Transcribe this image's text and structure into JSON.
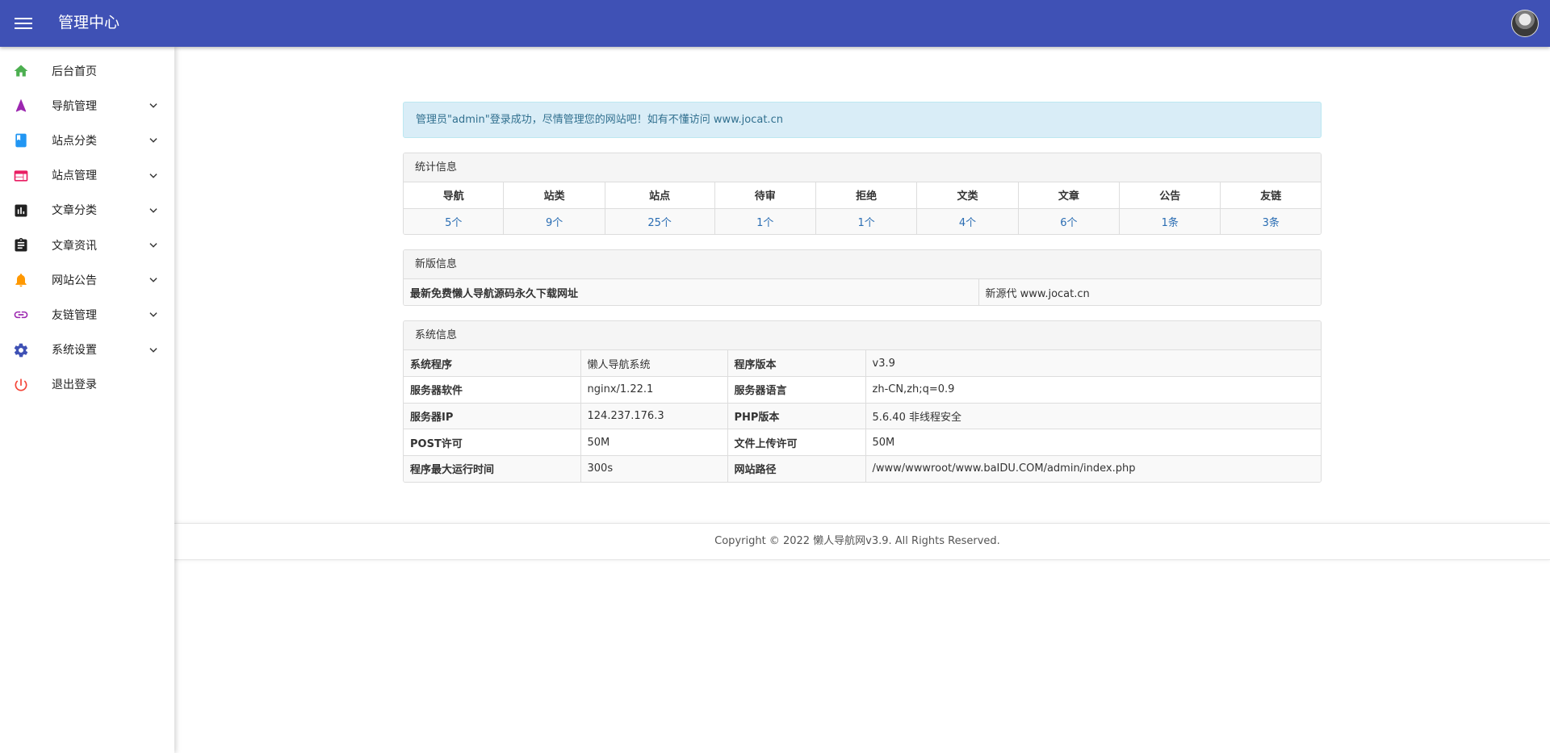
{
  "header": {
    "title": "管理中心"
  },
  "sidebar": {
    "items": [
      {
        "label": "后台首页",
        "icon": "home-icon",
        "color": "#4caf50",
        "expandable": false
      },
      {
        "label": "导航管理",
        "icon": "navigation-icon",
        "color": "#9c27b0",
        "expandable": true
      },
      {
        "label": "站点分类",
        "icon": "book-icon",
        "color": "#2196f3",
        "expandable": true
      },
      {
        "label": "站点管理",
        "icon": "web-icon",
        "color": "#e91e63",
        "expandable": true
      },
      {
        "label": "文章分类",
        "icon": "chart-icon",
        "color": "#212121",
        "expandable": true
      },
      {
        "label": "文章资讯",
        "icon": "clipboard-icon",
        "color": "#212121",
        "expandable": true
      },
      {
        "label": "网站公告",
        "icon": "bell-icon",
        "color": "#ff9800",
        "expandable": true
      },
      {
        "label": "友链管理",
        "icon": "link-icon",
        "color": "#9c27b0",
        "expandable": true
      },
      {
        "label": "系统设置",
        "icon": "gear-icon",
        "color": "#3f51b5",
        "expandable": true
      },
      {
        "label": "退出登录",
        "icon": "power-icon",
        "color": "#f44336",
        "expandable": false
      }
    ]
  },
  "alert": {
    "text": "管理员\"admin\"登录成功，尽情管理您的网站吧！如有不懂访问 www.jocat.cn"
  },
  "stats": {
    "title": "统计信息",
    "headers": [
      "导航",
      "站类",
      "站点",
      "待审",
      "拒绝",
      "文类",
      "文章",
      "公告",
      "友链"
    ],
    "values": [
      "5个",
      "9个",
      "25个",
      "1个",
      "1个",
      "4个",
      "6个",
      "1条",
      "3条"
    ]
  },
  "version": {
    "title": "新版信息",
    "label": "最新免费懒人导航源码永久下载网址",
    "value": "新源代 www.jocat.cn"
  },
  "system": {
    "title": "系统信息",
    "rows": [
      {
        "k1": "系统程序",
        "v1": "懒人导航系统",
        "k2": "程序版本",
        "v2": "v3.9"
      },
      {
        "k1": "服务器软件",
        "v1": "nginx/1.22.1",
        "k2": "服务器语言",
        "v2": "zh-CN,zh;q=0.9"
      },
      {
        "k1": "服务器IP",
        "v1": "124.237.176.3",
        "k2": "PHP版本",
        "v2": "5.6.40 非线程安全"
      },
      {
        "k1": "POST许可",
        "v1": "50M",
        "k2": "文件上传许可",
        "v2": "50M"
      },
      {
        "k1": "程序最大运行时间",
        "v1": "300s",
        "k2": "网站路径",
        "v2": "/www/wwwroot/www.baIDU.COM/admin/index.php"
      }
    ]
  },
  "footer": {
    "text": "Copyright © 2022 懒人导航网v3.9. All Rights Reserved."
  }
}
